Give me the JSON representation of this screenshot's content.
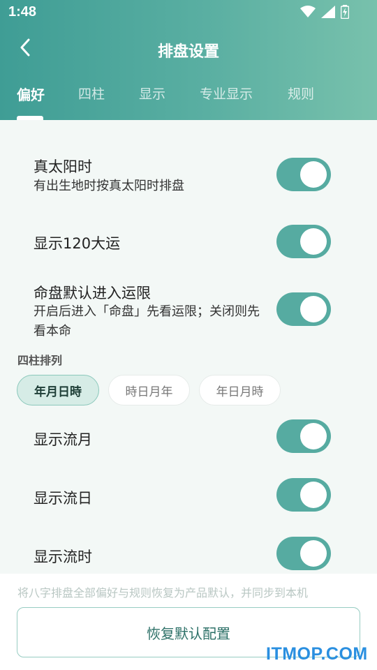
{
  "status_bar": {
    "time": "1:48",
    "icons": [
      "wifi-icon",
      "signal-icon",
      "battery-charging-icon"
    ]
  },
  "nav": {
    "back_icon": "chevron-left-icon",
    "title": "排盘设置"
  },
  "tabs": [
    {
      "label": "偏好",
      "active": true
    },
    {
      "label": "四柱",
      "active": false
    },
    {
      "label": "显示",
      "active": false
    },
    {
      "label": "专业显示",
      "active": false
    },
    {
      "label": "规则",
      "active": false
    }
  ],
  "settings": [
    {
      "title": "真太阳时",
      "subtitle": "有出生地时按真太阳时排盘",
      "on": true
    },
    {
      "title": "显示120大运",
      "subtitle": "",
      "on": true
    },
    {
      "title": "命盘默认进入运限",
      "subtitle": "开启后进入「命盘」先看运限；关闭则先看本命",
      "on": true
    }
  ],
  "pillar_order": {
    "label": "四柱排列",
    "options": [
      {
        "label": "年月日時",
        "selected": true
      },
      {
        "label": "時日月年",
        "selected": false
      },
      {
        "label": "年日月時",
        "selected": false
      }
    ]
  },
  "flow_settings": [
    {
      "title": "显示流月",
      "on": true
    },
    {
      "title": "显示流日",
      "on": true
    },
    {
      "title": "显示流时",
      "on": true
    }
  ],
  "footer": {
    "note": "将八字排盘全部偏好与规则恢复为产品默认，并同步到本机",
    "restore_label": "恢复默认配置"
  },
  "watermark": "ITMOP.COM",
  "colors": {
    "header_start": "#3f9d95",
    "header_end": "#78c1ac",
    "toggle_on": "#56aba1",
    "chip_active_bg": "#d6ece6",
    "watermark": "#2a8fe0"
  }
}
